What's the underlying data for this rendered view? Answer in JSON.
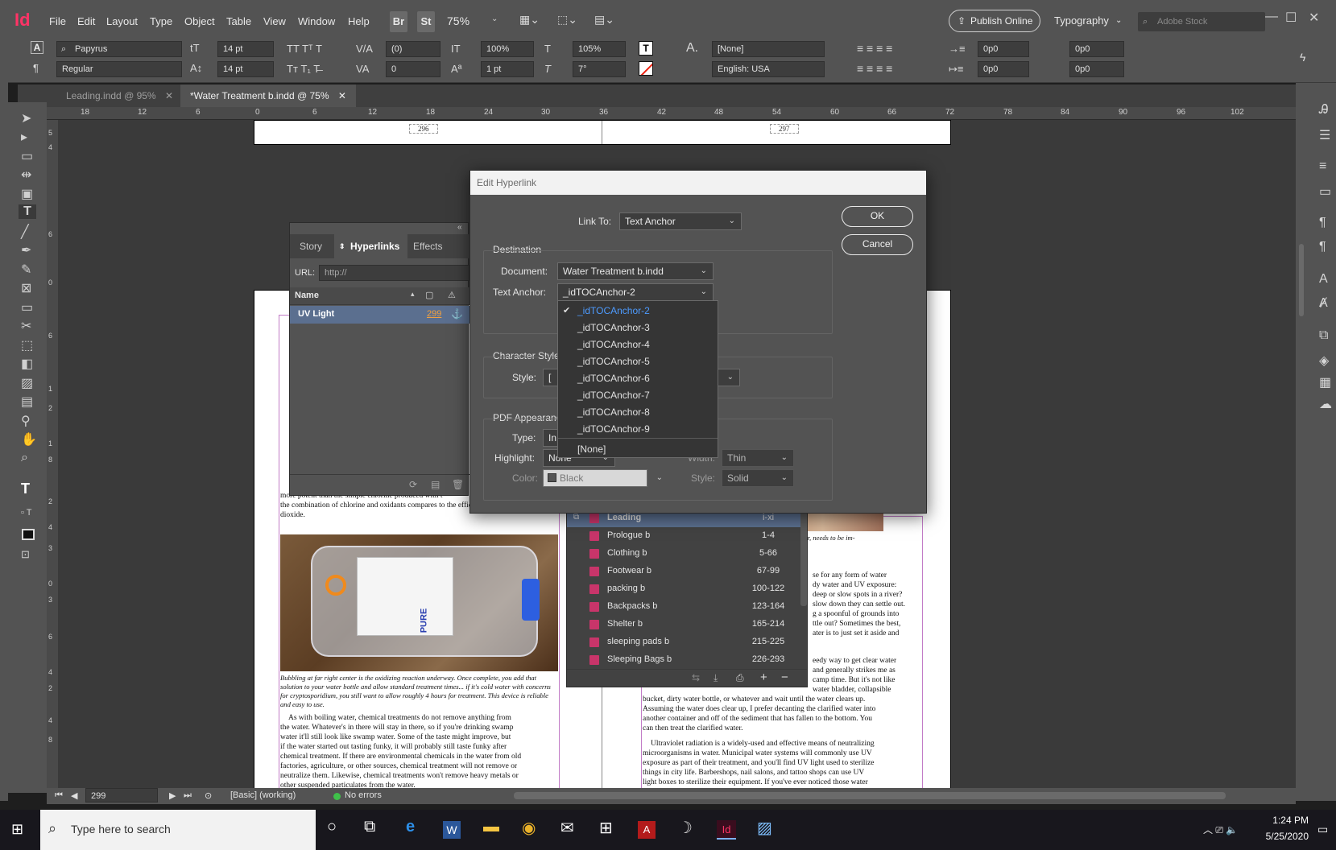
{
  "app": {
    "logo": "Id",
    "menus": [
      "File",
      "Edit",
      "Layout",
      "Type",
      "Object",
      "Table",
      "View",
      "Window",
      "Help"
    ],
    "bridge_btn": "Br",
    "stock_btn": "St",
    "zoom": "75%",
    "publish_label": "Publish Online",
    "workspace": "Typography",
    "search_placeholder": "Adobe Stock"
  },
  "control": {
    "font_family": "Papyrus",
    "font_style": "Regular",
    "font_size": "14 pt",
    "leading": "14 pt",
    "kerning": "(0)",
    "tracking": "0",
    "vscale": "100%",
    "hscale": "105%",
    "baseline": "1 pt",
    "skew": "7°",
    "char_style": "[None]",
    "language": "English: USA",
    "indent_left": "0p0",
    "indent_left2": "0p0",
    "indent_right": "0p0",
    "indent_right2": "0p0"
  },
  "tabs": [
    {
      "label": "Leading.indd @ 95%"
    },
    {
      "label": "*Water Treatment b.indd @ 75%"
    }
  ],
  "ruler": [
    "18",
    "12",
    "6",
    "0",
    "6",
    "12",
    "18",
    "24",
    "30",
    "36",
    "42",
    "48",
    "54",
    "60",
    "66",
    "72",
    "78",
    "84",
    "90",
    "96",
    "102"
  ],
  "vruler": [
    "5",
    "4",
    "6",
    "0",
    "6",
    "1",
    "2",
    "1",
    "8",
    "2",
    "4",
    "3",
    "0",
    "3",
    "6",
    "4",
    "2",
    "4",
    "8"
  ],
  "page_numbers": {
    "left": "296",
    "right": "297"
  },
  "hyperlinks_panel": {
    "tabs": [
      "Story",
      "Hyperlinks",
      "Effects"
    ],
    "url_label": "URL:",
    "url_value": "http://",
    "name_header": "Name",
    "row_name": "UV Light",
    "row_page": "299"
  },
  "dialog": {
    "title": "Edit Hyperlink",
    "link_to_label": "Link To:",
    "link_to_value": "Text Anchor",
    "ok": "OK",
    "cancel": "Cancel",
    "destination_label": "Destination",
    "document_label": "Document:",
    "document_value": "Water Treatment b.indd",
    "anchor_label": "Text Anchor:",
    "anchor_value": "_idTOCAnchor-2",
    "char_style_label": "Character Style",
    "style_label": "Style:",
    "style_value": "[",
    "pdf_label": "PDF Appearance",
    "type_label": "Type:",
    "type_value": "In",
    "highlight_label": "Highlight:",
    "highlight_value": "None",
    "color_label": "Color:",
    "color_value": "Black",
    "width_label": "Width:",
    "width_value": "Thin",
    "style2_label": "Style:",
    "style2_value": "Solid"
  },
  "dropdown_items": [
    "_idTOCAnchor-2",
    "_idTOCAnchor-3",
    "_idTOCAnchor-4",
    "_idTOCAnchor-5",
    "_idTOCAnchor-6",
    "_idTOCAnchor-7",
    "_idTOCAnchor-8",
    "_idTOCAnchor-9",
    "[None]"
  ],
  "book": [
    {
      "name": "Leading",
      "pages": "i-xi"
    },
    {
      "name": "Prologue b",
      "pages": "1-4"
    },
    {
      "name": "Clothing b",
      "pages": "5-66"
    },
    {
      "name": "Footwear b",
      "pages": "67-99"
    },
    {
      "name": "packing b",
      "pages": "100-122"
    },
    {
      "name": "Backpacks b",
      "pages": "123-164"
    },
    {
      "name": "Shelter b",
      "pages": "165-214"
    },
    {
      "name": "sleeping pads b",
      "pages": "215-225"
    },
    {
      "name": "Sleeping Bags b",
      "pages": "226-293"
    }
  ],
  "page_text": {
    "left_top": "more potent than the simple chlorine produced with t",
    "left_2": "the combination of chlorine and oxidants compares to the efficacy of chlorine",
    "left_3": "dioxide.",
    "caption1": "Bubbling at far right center is the oxidizing reaction underway. Once complete, you add that",
    "caption2": "solution to your water bottle and allow standard treatment times... if it's cold water with concerns",
    "caption3": "for cryptosporidium, you still want to allow roughly 4 hours for treatment. This device is reliable",
    "caption4": "and easy to use.",
    "body1": "As with boiling water, chemical treatments do not remove anything from",
    "body2": "the water. Whatever's in there will stay in there, so if you're drinking swamp",
    "body3": "water it'll still look like swamp water. Some of the taste might improve, but",
    "body4": "if the water started out tasting funky, it will probably still taste funky after",
    "body5": "chemical treatment. If there are environmental chemicals in the water from old",
    "body6": "factories, agriculture, or other sources, chemical treatment will not remove or",
    "body7": "neutralize them. Likewise, chemical treatments won't remove heavy metals or",
    "body8": "other suspended particulates from the water.",
    "right_cap": "ed button, center, needs to be im-",
    "r1": "se for any form of water",
    "r2": "dy water and UV exposure:",
    "r3": "deep or slow spots in a river?",
    "r4": "slow down they can settle out.",
    "r5": "g a spoonful of grounds into",
    "r6": "ttle out? Sometimes the best,",
    "r7": "ater is to just set it aside and",
    "r8": "eedy way to get clear water",
    "r9": "and generally strikes me as",
    "r10": "camp time. But it's not like",
    "r11": "water bladder, collapsible",
    "r12": "bucket, dirty water bottle, or whatever and wait until the water clears up.",
    "r13": "Assuming the water does clear up, I prefer decanting the clarified water into",
    "r14": "another container and off of the sediment that has fallen to the bottom. You",
    "r15": "can then treat the clarified water.",
    "r16": "Ultraviolet radiation is a widely-used and effective means of neutralizing",
    "r17": "microorganisms in water. Municipal water systems will commonly use UV",
    "r18": "exposure as part of their treatment, and you'll find UV light used to sterilize",
    "r19": "things in city life. Barbershops, nail salons, and tattoo shops can use UV",
    "r20": "light boxes to sterilize their equipment. If you've ever noticed those water",
    "device_brand": "PURE"
  },
  "status": {
    "page": "299",
    "style": "[Basic] (working)",
    "errors": "No errors"
  },
  "taskbar": {
    "search": "Type here to search",
    "time": "1:24 PM",
    "date": "5/25/2020"
  }
}
